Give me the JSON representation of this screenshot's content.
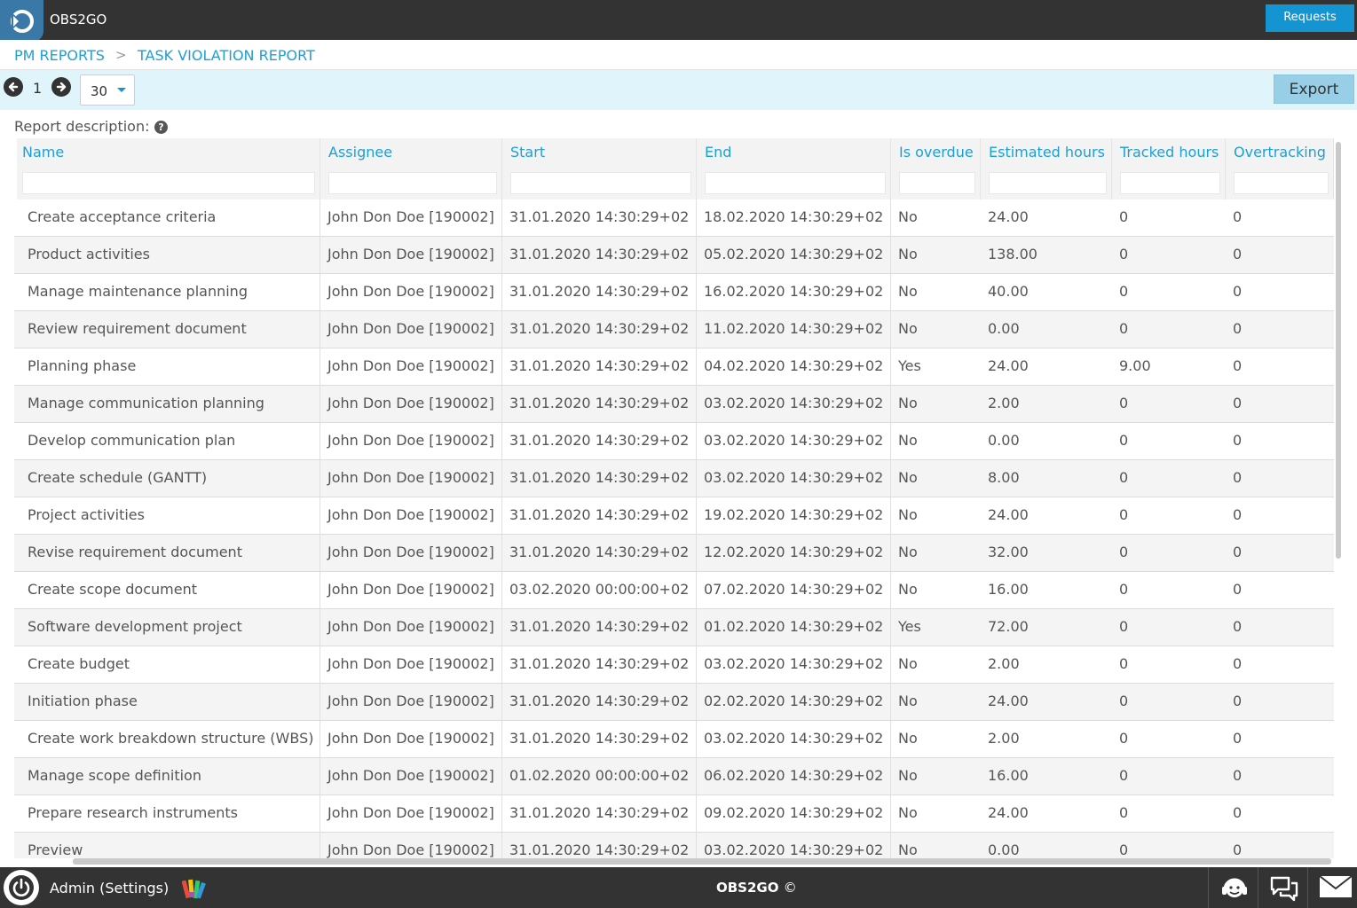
{
  "app": {
    "title": "OBS2GO"
  },
  "header": {
    "requests_label": "Requests"
  },
  "breadcrumb": {
    "items": [
      "PM REPORTS",
      "TASK VIOLATION REPORT"
    ],
    "separator": ">"
  },
  "toolbar": {
    "page": "1",
    "page_size": "30",
    "export_label": "Export"
  },
  "report": {
    "description_label": "Report description:"
  },
  "table": {
    "columns": [
      "Name",
      "Assignee",
      "Start",
      "End",
      "Is overdue",
      "Estimated hours",
      "Tracked hours",
      "Overtracking"
    ],
    "rows": [
      [
        "Create acceptance criteria",
        "John Don Doe [190002]",
        "31.01.2020 14:30:29+02",
        "18.02.2020 14:30:29+02",
        "No",
        "24.00",
        "0",
        "0"
      ],
      [
        "Product activities",
        "John Don Doe [190002]",
        "31.01.2020 14:30:29+02",
        "05.02.2020 14:30:29+02",
        "No",
        "138.00",
        "0",
        "0"
      ],
      [
        "Manage maintenance planning",
        "John Don Doe [190002]",
        "31.01.2020 14:30:29+02",
        "16.02.2020 14:30:29+02",
        "No",
        "40.00",
        "0",
        "0"
      ],
      [
        "Review requirement document",
        "John Don Doe [190002]",
        "31.01.2020 14:30:29+02",
        "11.02.2020 14:30:29+02",
        "No",
        "0.00",
        "0",
        "0"
      ],
      [
        "Planning phase",
        "John Don Doe [190002]",
        "31.01.2020 14:30:29+02",
        "04.02.2020 14:30:29+02",
        "Yes",
        "24.00",
        "9.00",
        "0"
      ],
      [
        "Manage communication planning",
        "John Don Doe [190002]",
        "31.01.2020 14:30:29+02",
        "03.02.2020 14:30:29+02",
        "No",
        "2.00",
        "0",
        "0"
      ],
      [
        "Develop communication plan",
        "John Don Doe [190002]",
        "31.01.2020 14:30:29+02",
        "03.02.2020 14:30:29+02",
        "No",
        "0.00",
        "0",
        "0"
      ],
      [
        "Create schedule (GANTT)",
        "John Don Doe [190002]",
        "31.01.2020 14:30:29+02",
        "03.02.2020 14:30:29+02",
        "No",
        "8.00",
        "0",
        "0"
      ],
      [
        "Project activities",
        "John Don Doe [190002]",
        "31.01.2020 14:30:29+02",
        "19.02.2020 14:30:29+02",
        "No",
        "24.00",
        "0",
        "0"
      ],
      [
        "Revise requirement document",
        "John Don Doe [190002]",
        "31.01.2020 14:30:29+02",
        "12.02.2020 14:30:29+02",
        "No",
        "32.00",
        "0",
        "0"
      ],
      [
        "Create scope document",
        "John Don Doe [190002]",
        "03.02.2020 00:00:00+02",
        "07.02.2020 14:30:29+02",
        "No",
        "16.00",
        "0",
        "0"
      ],
      [
        "Software development project",
        "John Don Doe [190002]",
        "31.01.2020 14:30:29+02",
        "01.02.2020 14:30:29+02",
        "Yes",
        "72.00",
        "0",
        "0"
      ],
      [
        "Create budget",
        "John Don Doe [190002]",
        "31.01.2020 14:30:29+02",
        "03.02.2020 14:30:29+02",
        "No",
        "2.00",
        "0",
        "0"
      ],
      [
        "Initiation phase",
        "John Don Doe [190002]",
        "31.01.2020 14:30:29+02",
        "02.02.2020 14:30:29+02",
        "No",
        "24.00",
        "0",
        "0"
      ],
      [
        "Create work breakdown structure (WBS)",
        "John Don Doe [190002]",
        "31.01.2020 14:30:29+02",
        "03.02.2020 14:30:29+02",
        "No",
        "2.00",
        "0",
        "0"
      ],
      [
        "Manage scope definition",
        "John Don Doe [190002]",
        "01.02.2020 00:00:00+02",
        "06.02.2020 14:30:29+02",
        "No",
        "16.00",
        "0",
        "0"
      ],
      [
        "Prepare research instruments",
        "John Don Doe [190002]",
        "31.01.2020 14:30:29+02",
        "09.02.2020 14:30:29+02",
        "No",
        "24.00",
        "0",
        "0"
      ],
      [
        "Preview",
        "John Don Doe [190002]",
        "31.01.2020 14:30:29+02",
        "03.02.2020 14:30:29+02",
        "No",
        "0.00",
        "0",
        "0"
      ]
    ]
  },
  "footer": {
    "user_label": "Admin (Settings)",
    "brand": "OBS2GO",
    "copyright": "©"
  },
  "icons": {
    "logo": "obs2go-logo-icon",
    "prev": "arrow-left-circle-icon",
    "next": "arrow-right-circle-icon",
    "help": "question-circle-icon",
    "power": "power-icon",
    "palette": "color-palette-icon",
    "support": "support-headset-icon",
    "chat": "chat-bubbles-icon",
    "mail": "envelope-icon"
  },
  "colors": {
    "accent": "#1e9fd4",
    "topbar": "#333333",
    "toolbar_bg": "#e0f4fc",
    "button": "#1495d1"
  }
}
